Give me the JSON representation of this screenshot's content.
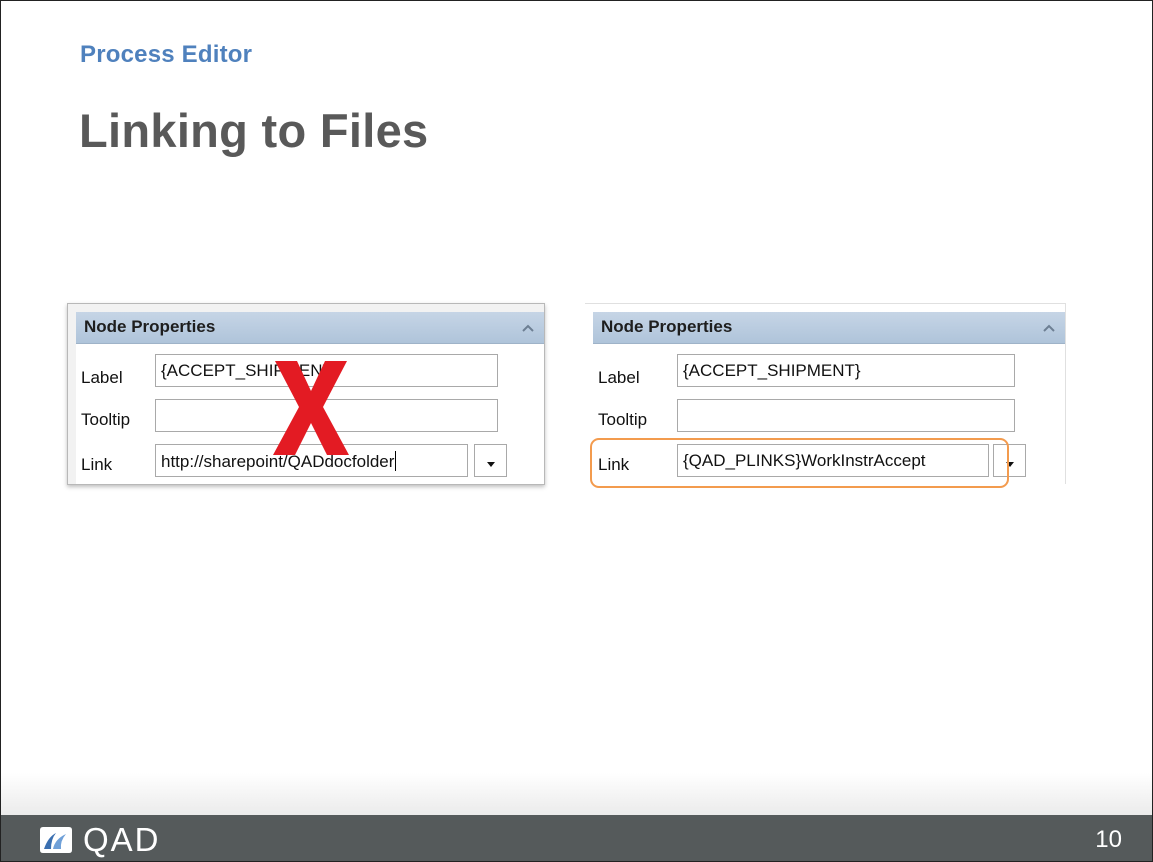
{
  "slide": {
    "section_title": "Process Editor",
    "title": "Linking to Files",
    "page_number": "10"
  },
  "footer": {
    "logo_text": "QAD"
  },
  "panel_left": {
    "header": "Node Properties",
    "label_caption": "Label",
    "label_value": "{ACCEPT_SHIPMENT}",
    "tooltip_caption": "Tooltip",
    "tooltip_value": "",
    "link_caption": "Link",
    "link_value": "http://sharepoint/QADdocfolder"
  },
  "panel_right": {
    "header": "Node Properties",
    "label_caption": "Label",
    "label_value": "{ACCEPT_SHIPMENT}",
    "tooltip_caption": "Tooltip",
    "tooltip_value": "",
    "link_caption": "Link",
    "link_value": "{QAD_PLINKS}WorkInstrAccept"
  },
  "colors": {
    "section_title": "#4f81bd",
    "title": "#595959",
    "panel_header": "#b9cce0",
    "reject_mark": "#e31b23",
    "highlight": "#f39b4e",
    "footer": "#555a5b"
  },
  "icons": {
    "reject": "red-x-mark",
    "collapse": "chevron-up-icon",
    "dropdown": "dropdown-arrow-icon",
    "logo": "qad-logo-icon"
  }
}
